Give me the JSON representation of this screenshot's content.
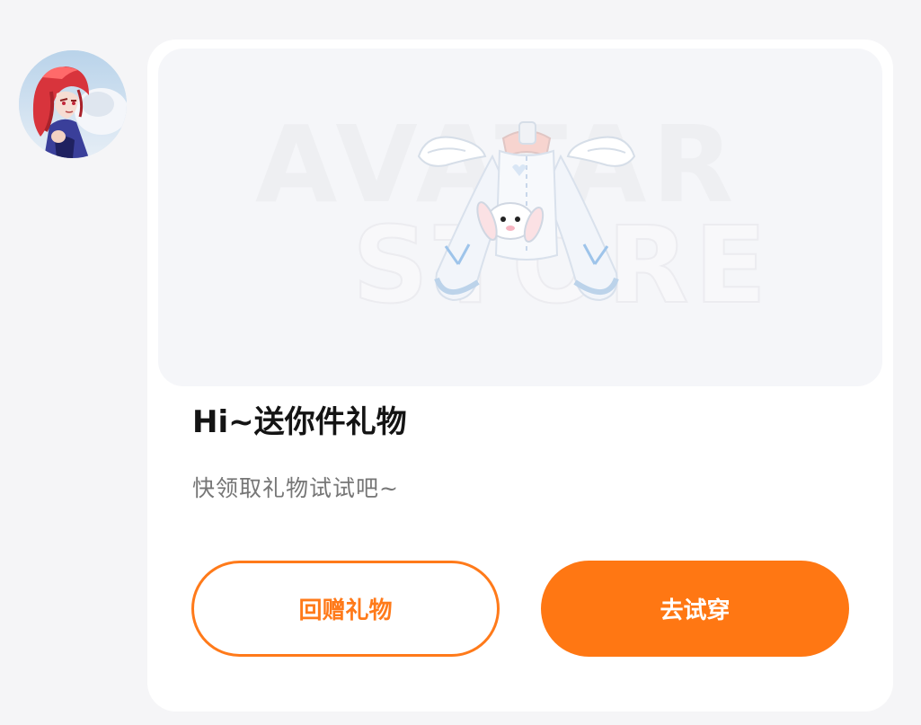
{
  "sender": {
    "avatar_icon": "character-avatar-icon"
  },
  "gift_card": {
    "banner": {
      "watermark_line1": "AVATAR",
      "watermark_line2": "STORE",
      "item_icon": "bunny-outfit-icon"
    },
    "title": "Hi~送你件礼物",
    "subtitle": "快领取礼物试试吧~",
    "actions": {
      "return_gift_label": "回赠礼物",
      "try_on_label": "去试穿"
    }
  },
  "colors": {
    "accent": "#ff7713",
    "title_text": "#141414",
    "subtitle_text": "#767676",
    "page_background": "#f5f5f7",
    "card_background": "#ffffff"
  }
}
